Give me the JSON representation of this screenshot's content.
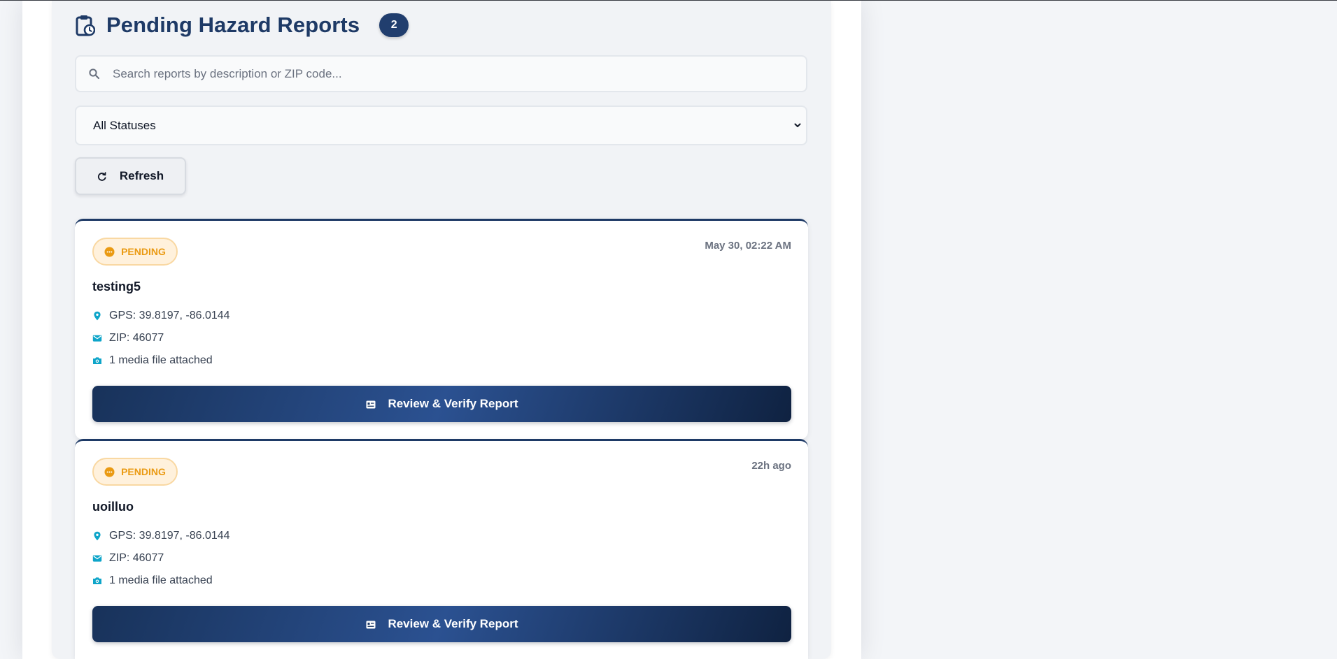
{
  "header": {
    "title": "Pending Hazard Reports",
    "count": "2"
  },
  "search": {
    "placeholder": "Search reports by description or ZIP code...",
    "value": ""
  },
  "filter": {
    "selected": "All Statuses"
  },
  "toolbar": {
    "refresh_label": "Refresh"
  },
  "reports": [
    {
      "status": "PENDING",
      "time": "May 30, 02:22 AM",
      "title": "testing5",
      "gps": "GPS: 39.8197, -86.0144",
      "zip": "ZIP: 46077",
      "media": "1 media file attached",
      "action": "Review & Verify Report"
    },
    {
      "status": "PENDING",
      "time": "22h ago",
      "title": "uoilluo",
      "gps": "GPS: 39.8197, -86.0144",
      "zip": "ZIP: 46077",
      "media": "1 media file attached",
      "action": "Review & Verify Report"
    }
  ],
  "colors": {
    "primary": "#1e3a66",
    "pending_text": "#ea9a12",
    "pending_bg": "#fff1dc",
    "meta_icon": "#0ea5c9"
  },
  "icons": {
    "header": "clipboard-clock-icon",
    "search": "search-icon",
    "refresh": "refresh-icon",
    "status": "pending-clock-icon",
    "gps": "map-pin-icon",
    "zip": "envelope-icon",
    "media": "camera-icon",
    "review": "id-card-icon"
  }
}
